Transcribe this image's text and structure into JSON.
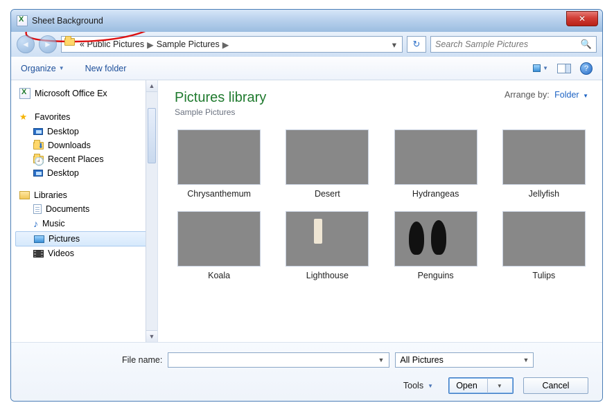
{
  "window": {
    "title": "Sheet Background"
  },
  "nav": {
    "breadcrumb_prefix": "«",
    "crumb1": "Public Pictures",
    "crumb2": "Sample Pictures"
  },
  "search": {
    "placeholder": "Search Sample Pictures"
  },
  "toolbar": {
    "organize": "Organize",
    "newfolder": "New folder"
  },
  "sidebar": {
    "top_item": "Microsoft Office Ex",
    "favorites_header": "Favorites",
    "libraries_header": "Libraries",
    "favorites": [
      {
        "label": "Desktop"
      },
      {
        "label": "Downloads"
      },
      {
        "label": "Recent Places"
      },
      {
        "label": "Desktop"
      }
    ],
    "libraries": [
      {
        "label": "Documents"
      },
      {
        "label": "Music"
      },
      {
        "label": "Pictures",
        "selected": true
      },
      {
        "label": "Videos"
      }
    ]
  },
  "library": {
    "title": "Pictures library",
    "subtitle": "Sample Pictures",
    "arrange_label": "Arrange by:",
    "arrange_value": "Folder"
  },
  "items": [
    {
      "caption": "Chrysanthemum",
      "cls": "chrys"
    },
    {
      "caption": "Desert",
      "cls": "desert"
    },
    {
      "caption": "Hydrangeas",
      "cls": "hydra"
    },
    {
      "caption": "Jellyfish",
      "cls": "jelly"
    },
    {
      "caption": "Koala",
      "cls": "koala"
    },
    {
      "caption": "Lighthouse",
      "cls": "light"
    },
    {
      "caption": "Penguins",
      "cls": "peng"
    },
    {
      "caption": "Tulips",
      "cls": "tulip"
    }
  ],
  "footer": {
    "filename_label": "File name:",
    "filename_value": "",
    "filter_value": "All Pictures",
    "tools_label": "Tools",
    "open_label": "Open",
    "cancel_label": "Cancel"
  }
}
